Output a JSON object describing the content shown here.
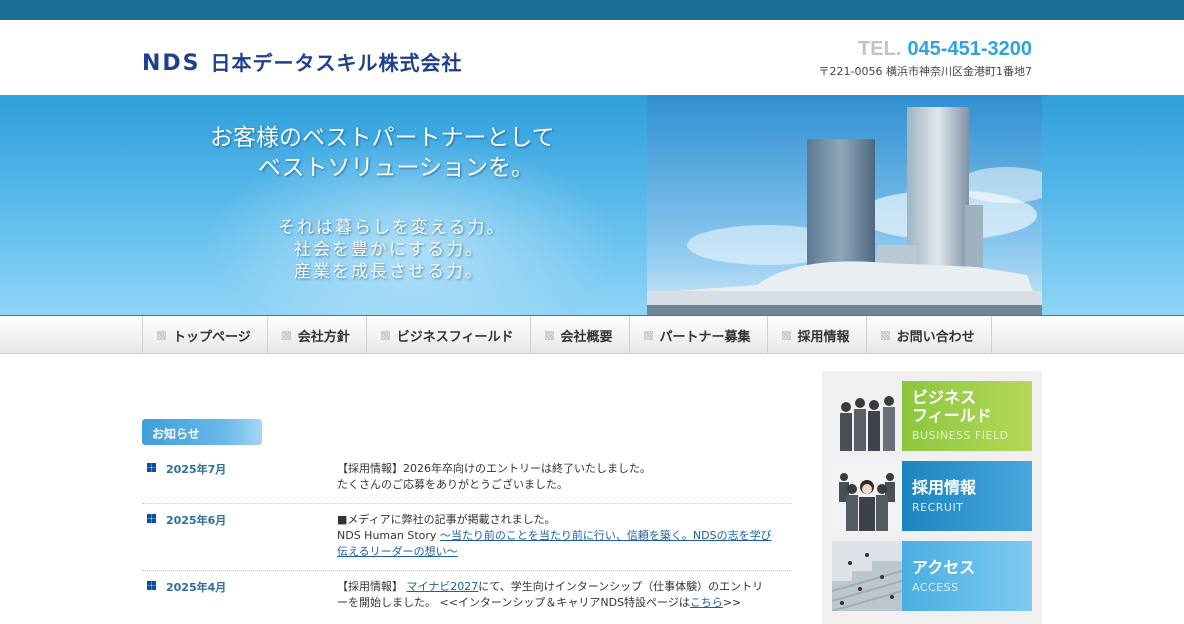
{
  "header": {
    "logo_mark": "NDS",
    "company_name": "日本データスキル株式会社",
    "tel_label": "TEL.",
    "tel_number": "045-451-3200",
    "address": "〒221-0056 横浜市神奈川区金港町1番地7"
  },
  "hero": {
    "tagline_1": "お客様のベストパートナーとして",
    "tagline_2": "ベストソリューションを。",
    "sub_1": "それは暮らしを変える力。",
    "sub_2": "社会を豊かにする力。",
    "sub_3": "産業を成長させる力。"
  },
  "nav": {
    "items": [
      "トップページ",
      "会社方針",
      "ビジネスフィールド",
      "会社概要",
      "パートナー募集",
      "採用情報",
      "お問い合わせ"
    ]
  },
  "news": {
    "title": "お知らせ",
    "items": [
      {
        "date": "2025年7月",
        "line1": "【採用情報】2026年卒向けのエントリーは終了いたしました。",
        "line2": "たくさんのご応募をありがとうございました。"
      },
      {
        "date": "2025年6月",
        "line1": "■メディアに弊社の記事が掲載されました。",
        "prefix": "NDS Human Story ",
        "link": "〜当たり前のことを当たり前に行い、信頼を築く。NDSの志を学び伝えるリーダーの想い〜"
      },
      {
        "date": "2025年4月",
        "prefix": "【採用情報】 ",
        "link": "マイナビ2027",
        "middle": "にて、学生向けインターンシップ（仕事体験）のエントリーを開始しました。 <<インターンシップ＆キャリアNDS特設ページは",
        "link2": "こちら",
        "suffix": ">>"
      }
    ]
  },
  "side": {
    "b1_jp_1": "ビジネス",
    "b1_jp_2": "フィールド",
    "b1_en": "BUSINESS FIELD",
    "b2_jp": "採用情報",
    "b2_en": "RECRUIT",
    "b3_jp": "アクセス",
    "b3_en": "ACCESS"
  },
  "colors": {
    "topbar": "#1e6f98",
    "logo": "#1f3f8f",
    "tel": "#2fa3dc",
    "banner_business": "#8cc63f",
    "banner_recruit": "#1b84bf",
    "banner_access": "#4aaee2"
  }
}
